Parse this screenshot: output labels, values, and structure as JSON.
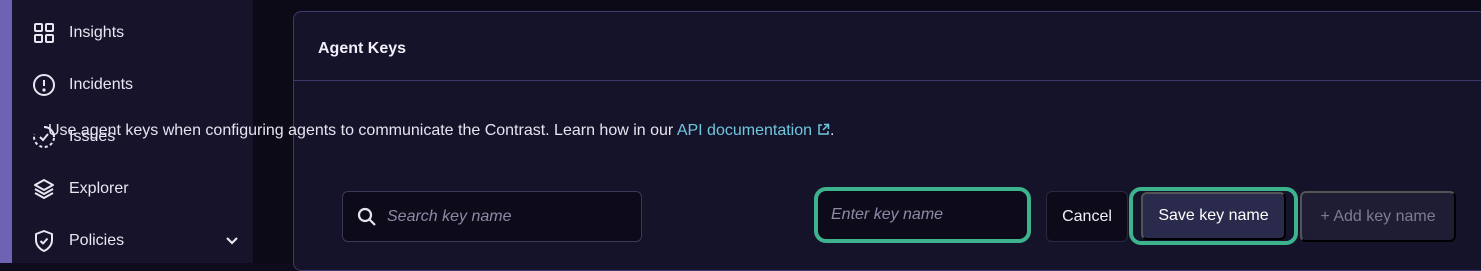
{
  "sidebar": {
    "items": [
      {
        "label": "Insights",
        "icon": "grid-icon"
      },
      {
        "label": "Incidents",
        "icon": "alert-circle-icon"
      },
      {
        "label": "Issues",
        "icon": "progress-check-icon"
      },
      {
        "label": "Explorer",
        "icon": "layers-icon"
      },
      {
        "label": "Policies",
        "icon": "shield-check-icon",
        "expandable": true
      }
    ]
  },
  "card": {
    "title": "Agent Keys",
    "description_prefix": "Use agent keys when configuring agents to communicate the Contrast. Learn how in our ",
    "link_label": "API documentation",
    "description_suffix": "."
  },
  "search": {
    "placeholder": "Search key name",
    "value": ""
  },
  "key_input": {
    "placeholder": "Enter key name",
    "value": ""
  },
  "buttons": {
    "cancel": "Cancel",
    "save": "Save key name",
    "add": "+ Add key name"
  },
  "colors": {
    "accent": "#6e62b5",
    "focus_ring": "#3db38d",
    "link": "#6fc7de",
    "sidebar_bg": "#16132b",
    "card_bg": "#15132a"
  }
}
